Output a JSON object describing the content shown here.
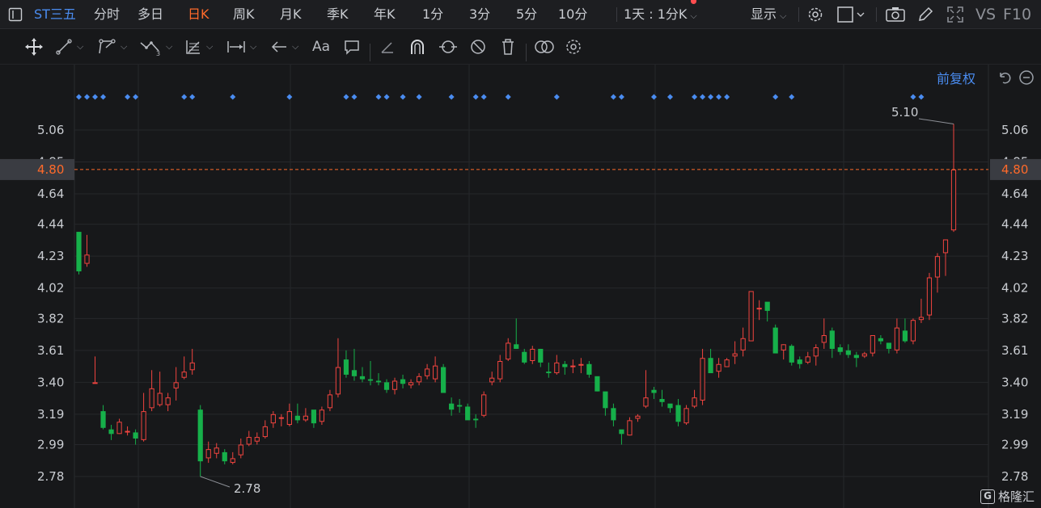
{
  "topbar": {
    "ticker": "ST三五",
    "periods": [
      "分时",
      "多日",
      "日K",
      "周K",
      "月K",
      "季K",
      "年K",
      "1分",
      "3分",
      "5分",
      "10分"
    ],
    "active_period": "日K",
    "interval_select": "1天 : 1分K",
    "display_label": "显示",
    "compare_label": "VS",
    "f10_label": "F10"
  },
  "toolbar": {
    "text_tool_label": "Aa"
  },
  "chart": {
    "adjust_label": "前复权",
    "current_price_label": "4.80",
    "high_label": "5.10",
    "low_label": "2.78",
    "y_tick_labels": [
      "5.06",
      "4.85",
      "4.64",
      "4.44",
      "4.23",
      "4.02",
      "3.82",
      "3.61",
      "3.40",
      "3.19",
      "2.99",
      "2.78"
    ],
    "watermark": "格隆汇",
    "colors": {
      "up": "#f0443f",
      "down": "#16b04a",
      "price_line": "#ff6a2a",
      "marker": "#4a8cf0",
      "accent": "#ff6a2a"
    }
  },
  "chart_data": {
    "type": "candlestick",
    "ylim": [
      2.72,
      5.16
    ],
    "current_price": 4.8,
    "high": 5.1,
    "low": 2.78,
    "candles": [
      [
        4.39,
        4.39,
        4.11,
        4.13
      ],
      [
        4.18,
        4.37,
        4.16,
        4.24
      ],
      [
        3.4,
        3.57,
        3.4,
        3.4
      ],
      [
        3.21,
        3.25,
        3.09,
        3.1
      ],
      [
        3.09,
        3.12,
        3.02,
        3.06
      ],
      [
        3.06,
        3.16,
        3.06,
        3.14
      ],
      [
        3.08,
        3.11,
        3.05,
        3.08
      ],
      [
        3.07,
        3.09,
        2.99,
        3.03
      ],
      [
        3.02,
        3.33,
        3.01,
        3.21
      ],
      [
        3.23,
        3.48,
        3.21,
        3.36
      ],
      [
        3.25,
        3.47,
        3.24,
        3.33
      ],
      [
        3.25,
        3.33,
        3.21,
        3.3
      ],
      [
        3.36,
        3.5,
        3.28,
        3.4
      ],
      [
        3.43,
        3.57,
        3.42,
        3.47
      ],
      [
        3.48,
        3.62,
        3.45,
        3.53
      ],
      [
        3.22,
        3.25,
        2.78,
        2.88
      ],
      [
        2.9,
        3.01,
        2.87,
        2.96
      ],
      [
        2.93,
        3.0,
        2.9,
        2.97
      ],
      [
        2.94,
        2.96,
        2.86,
        2.88
      ],
      [
        2.87,
        2.94,
        2.86,
        2.9
      ],
      [
        2.92,
        3.03,
        2.9,
        2.99
      ],
      [
        2.99,
        3.08,
        2.98,
        3.04
      ],
      [
        3.01,
        3.07,
        2.99,
        3.04
      ],
      [
        3.04,
        3.15,
        3.03,
        3.11
      ],
      [
        3.13,
        3.21,
        3.1,
        3.19
      ],
      [
        3.16,
        3.19,
        3.11,
        3.17
      ],
      [
        3.12,
        3.26,
        3.11,
        3.21
      ],
      [
        3.18,
        3.26,
        3.13,
        3.15
      ],
      [
        3.15,
        3.23,
        3.14,
        3.18
      ],
      [
        3.22,
        3.18,
        3.1,
        3.13
      ],
      [
        3.14,
        3.24,
        3.12,
        3.22
      ],
      [
        3.23,
        3.35,
        3.21,
        3.32
      ],
      [
        3.32,
        3.69,
        3.3,
        3.5
      ],
      [
        3.55,
        3.61,
        3.43,
        3.45
      ],
      [
        3.48,
        3.62,
        3.41,
        3.44
      ],
      [
        3.44,
        3.5,
        3.4,
        3.42
      ],
      [
        3.42,
        3.54,
        3.38,
        3.41
      ],
      [
        3.41,
        3.46,
        3.38,
        3.4
      ],
      [
        3.4,
        3.42,
        3.33,
        3.35
      ],
      [
        3.35,
        3.43,
        3.32,
        3.41
      ],
      [
        3.42,
        3.45,
        3.36,
        3.39
      ],
      [
        3.38,
        3.42,
        3.36,
        3.4
      ],
      [
        3.4,
        3.46,
        3.38,
        3.44
      ],
      [
        3.44,
        3.52,
        3.42,
        3.49
      ],
      [
        3.42,
        3.57,
        3.4,
        3.51
      ],
      [
        3.5,
        3.52,
        3.34,
        3.33
      ],
      [
        3.26,
        3.3,
        3.18,
        3.22
      ],
      [
        3.25,
        3.29,
        3.2,
        3.24
      ],
      [
        3.24,
        3.26,
        3.16,
        3.15
      ],
      [
        3.16,
        3.19,
        3.1,
        3.15
      ],
      [
        3.18,
        3.34,
        3.17,
        3.32
      ],
      [
        3.4,
        3.47,
        3.38,
        3.43
      ],
      [
        3.42,
        3.58,
        3.4,
        3.54
      ],
      [
        3.55,
        3.69,
        3.54,
        3.66
      ],
      [
        3.65,
        3.82,
        3.62,
        3.62
      ],
      [
        3.6,
        3.62,
        3.52,
        3.53
      ],
      [
        3.54,
        3.64,
        3.52,
        3.62
      ],
      [
        3.62,
        3.62,
        3.5,
        3.53
      ],
      [
        3.47,
        3.53,
        3.43,
        3.46
      ],
      [
        3.46,
        3.58,
        3.45,
        3.53
      ],
      [
        3.52,
        3.54,
        3.45,
        3.5
      ],
      [
        3.5,
        3.55,
        3.46,
        3.51
      ],
      [
        3.51,
        3.56,
        3.46,
        3.52
      ],
      [
        3.52,
        3.54,
        3.43,
        3.45
      ],
      [
        3.44,
        3.43,
        3.34,
        3.34
      ],
      [
        3.34,
        3.29,
        3.18,
        3.23
      ],
      [
        3.23,
        3.26,
        3.11,
        3.15
      ],
      [
        3.09,
        3.08,
        2.99,
        3.06
      ],
      [
        3.05,
        3.17,
        3.05,
        3.15
      ],
      [
        3.16,
        3.19,
        3.14,
        3.18
      ],
      [
        3.24,
        3.48,
        3.23,
        3.3
      ],
      [
        3.35,
        3.37,
        3.29,
        3.33
      ],
      [
        3.29,
        3.35,
        3.24,
        3.27
      ],
      [
        3.26,
        3.25,
        3.2,
        3.23
      ],
      [
        3.25,
        3.29,
        3.11,
        3.14
      ],
      [
        3.13,
        3.25,
        3.12,
        3.23
      ],
      [
        3.24,
        3.35,
        3.23,
        3.3
      ],
      [
        3.28,
        3.62,
        3.25,
        3.56
      ],
      [
        3.56,
        3.62,
        3.49,
        3.46
      ],
      [
        3.47,
        3.56,
        3.43,
        3.52
      ],
      [
        3.5,
        3.56,
        3.5,
        3.55
      ],
      [
        3.57,
        3.67,
        3.52,
        3.59
      ],
      [
        3.61,
        3.76,
        3.57,
        3.69
      ],
      [
        3.67,
        3.82,
        3.68,
        4.0
      ],
      [
        3.89,
        3.94,
        3.81,
        3.89
      ],
      [
        3.93,
        3.91,
        3.8,
        3.87
      ],
      [
        3.76,
        3.78,
        3.6,
        3.59
      ],
      [
        3.61,
        3.65,
        3.55,
        3.65
      ],
      [
        3.64,
        3.65,
        3.51,
        3.53
      ],
      [
        3.55,
        3.57,
        3.49,
        3.52
      ],
      [
        3.53,
        3.6,
        3.52,
        3.57
      ],
      [
        3.57,
        3.65,
        3.51,
        3.63
      ],
      [
        3.66,
        3.82,
        3.62,
        3.71
      ],
      [
        3.74,
        3.76,
        3.56,
        3.62
      ],
      [
        3.63,
        3.65,
        3.58,
        3.6
      ],
      [
        3.61,
        3.65,
        3.56,
        3.58
      ],
      [
        3.58,
        3.6,
        3.5,
        3.56
      ],
      [
        3.57,
        3.6,
        3.56,
        3.59
      ],
      [
        3.59,
        3.71,
        3.57,
        3.71
      ],
      [
        3.69,
        3.71,
        3.65,
        3.67
      ],
      [
        3.66,
        3.64,
        3.59,
        3.62
      ],
      [
        3.61,
        3.82,
        3.59,
        3.76
      ],
      [
        3.74,
        3.82,
        3.66,
        3.67
      ],
      [
        3.67,
        3.82,
        3.65,
        3.81
      ],
      [
        3.81,
        3.95,
        3.79,
        3.83
      ],
      [
        3.84,
        4.12,
        3.81,
        4.09
      ],
      [
        4.09,
        4.25,
        3.99,
        4.23
      ],
      [
        4.25,
        4.34,
        4.1,
        4.34
      ],
      [
        4.4,
        5.1,
        4.39,
        4.8
      ]
    ],
    "markers": [
      0,
      1,
      2,
      3,
      6,
      7,
      13,
      14,
      19,
      26,
      33,
      34,
      37,
      38,
      40,
      42,
      46,
      49,
      50,
      53,
      59,
      66,
      67,
      71,
      73,
      76,
      77,
      78,
      79,
      80,
      86,
      88,
      103,
      104
    ]
  }
}
